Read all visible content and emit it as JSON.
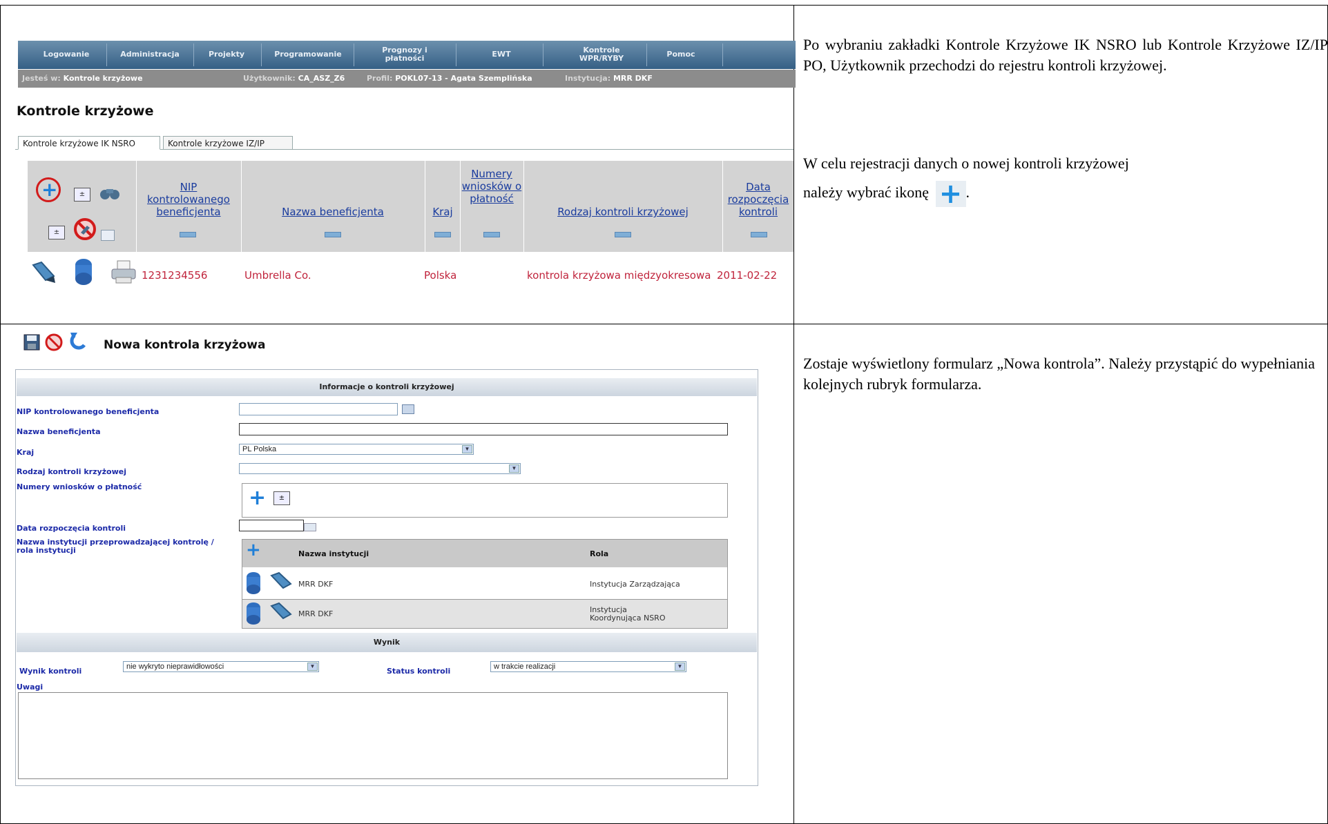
{
  "top_nav": {
    "items": [
      "Logowanie",
      "Administracja",
      "Projekty",
      "Programowanie",
      "Prognozy i płatności",
      "EWT",
      "Kontrole WPR/RYBY",
      "Pomoc"
    ]
  },
  "breadcrumb": {
    "location_label": "Jesteś w:",
    "location_value": "Kontrole krzyżowe",
    "user_label": "Użytkownik:",
    "user_value": "CA_ASZ_Z6",
    "profile_label": "Profil:",
    "profile_value": "POKL07-13 - Agata Szemplińska",
    "institution_label": "Instytucja:",
    "institution_value": "MRR DKF"
  },
  "register": {
    "title": "Kontrole krzyżowe",
    "tabs": [
      "Kontrole krzyżowe IK NSRO",
      "Kontrole krzyżowe IZ/IP"
    ],
    "columns": [
      "NIP kontrolowanego beneficjenta",
      "Nazwa beneficjenta",
      "Kraj",
      "Numery wniosków o płatność",
      "Rodzaj kontroli krzyżowej",
      "Data rozpoczęcia kontroli"
    ],
    "row": {
      "nip": "1231234556",
      "name": "Umbrella Co.",
      "country": "Polska",
      "type": "kontrola krzyżowa międzyokresowa",
      "date": "2011-02-22"
    }
  },
  "form": {
    "title": "Nowa kontrola krzyżowa",
    "section_info": "Informacje o kontroli krzyżowej",
    "labels": {
      "nip": "NIP kontrolowanego beneficjenta",
      "name": "Nazwa beneficjenta",
      "country": "Kraj",
      "type": "Rodzaj kontroli krzyżowej",
      "applications": "Numery wniosków o płatność",
      "start_date": "Data rozpoczęcia kontroli",
      "institution": "Nazwa instytucji przeprowadzającej kontrolę / rola instytucji"
    },
    "country_value": "PL Polska",
    "institution_table": {
      "col_name": "Nazwa instytucji",
      "col_role": "Rola",
      "rows": [
        {
          "name": "MRR DKF",
          "role": "Instytucja Zarządzająca"
        },
        {
          "name": "MRR DKF",
          "role": "Instytucja Koordynująca NSRO"
        }
      ]
    },
    "section_result": "Wynik",
    "result_label": "Wynik kontroli",
    "result_value": "nie wykryto nieprawidłowości",
    "status_label": "Status kontroli",
    "status_value": "w trakcie realizacji",
    "notes_label": "Uwagi"
  },
  "instructions": {
    "para1": "Po wybraniu zakładki Kontrole Krzyżowe IK NSRO lub Kontrole Krzyżowe IZ/IP PO, Użytkownik przechodzi do rejestru kontroli krzyżowej.",
    "para2": "W celu rejestracji danych o nowej kontroli krzyżowej",
    "para3_prefix": "należy wybrać ikonę",
    "para3_suffix": ".",
    "para4": "Zostaje wyświetlony formularz „Nowa kontrola”. Należy przystąpić do wypełniania kolejnych rubryk formularza."
  }
}
